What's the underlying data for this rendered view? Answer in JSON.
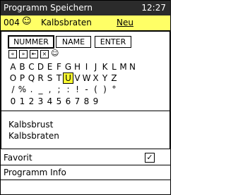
{
  "header": {
    "title": "Programm Speichern",
    "clock": "12:27"
  },
  "program": {
    "number": "004",
    "icon": "smiley-icon",
    "name": "Kalbsbraten",
    "new_label": "Neu"
  },
  "modes": [
    {
      "label": "NUMMER",
      "selected": true
    },
    {
      "label": "NAME",
      "selected": false
    },
    {
      "label": "ENTER",
      "selected": false
    }
  ],
  "controls": [
    "«",
    "»",
    "⇤",
    "×",
    "☺"
  ],
  "keyboard": {
    "row1": [
      "A",
      "B",
      "C",
      "D",
      "E",
      "F",
      "G",
      "H",
      "I",
      "J",
      "K",
      "L",
      "M",
      "N"
    ],
    "row2": [
      "O",
      "P",
      "Q",
      "R",
      "S",
      "T",
      "U",
      "V",
      "W",
      "X",
      "Y",
      "Z"
    ],
    "row3": [
      "/",
      "%",
      ".",
      "_",
      ",",
      ";",
      ":",
      "!",
      "-",
      "(",
      ")",
      "°"
    ],
    "row4": [
      "0",
      "1",
      "2",
      "3",
      "4",
      "5",
      "6",
      "7",
      "8",
      "9"
    ],
    "cursor_key": "U"
  },
  "results": [
    "Kalbsbrust",
    "Kalbsbraten"
  ],
  "menu": {
    "favorit_label": "Favorit",
    "favorit_checked": "✓",
    "info_label": "Programm Info"
  }
}
